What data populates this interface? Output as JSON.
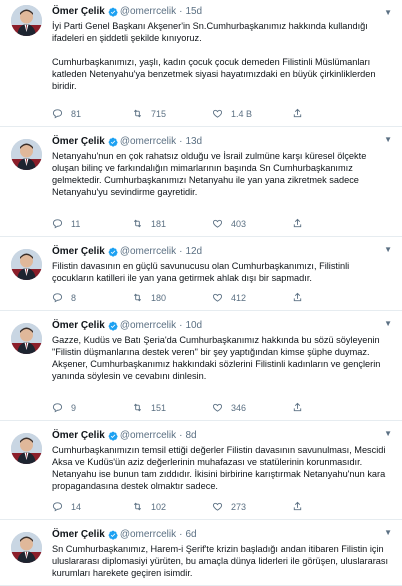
{
  "tweets": [
    {
      "name": "Ömer Çelik",
      "handle": "@omerrcelik",
      "dot": "·",
      "time": "15d",
      "text": "İyi Parti Genel Başkanı Akşener'in Sn.Cumhurbaşkanımız hakkında kullandığı ifadeleri en şiddetli şekilde kınıyoruz.\n\nCumhurbaşkanımızı, yaşlı, kadın çocuk çocuk demeden Filistinli Müslümanları katleden Netenyahu'ya benzetmek siyasi hayatımızdaki en büyük çirkinliklerden biridir.",
      "replies": "81",
      "retweets": "715",
      "likes": "1.4 B"
    },
    {
      "name": "Ömer Çelik",
      "handle": "@omerrcelik",
      "dot": "·",
      "time": "13d",
      "text": "Netanyahu'nun en çok rahatsız olduğu ve İsrail zulmüne karşı küresel ölçekte oluşan bilinç ve farkındalığın mimarlarının başında Sn Cumhurbaşkanımız gelmektedir. Cumhurbaşkanımızı Netanyahu ile yan yana zikretmek sadece Netanyahu'yu sevindirme gayretidir.",
      "replies": "11",
      "retweets": "181",
      "likes": "403"
    },
    {
      "name": "Ömer Çelik",
      "handle": "@omerrcelik",
      "dot": "·",
      "time": "12d",
      "text": "Filistin davasının en güçlü savunucusu olan Cumhurbaşkanımızı, Filistinli çocukların katilleri ile yan yana getirmek ahlak dışı bir sapmadır.",
      "replies": "8",
      "retweets": "180",
      "likes": "412"
    },
    {
      "name": "Ömer Çelik",
      "handle": "@omerrcelik",
      "dot": "·",
      "time": "10d",
      "text": "Gazze, Kudüs ve Batı Şeria'da Cumhurbaşkanımız hakkında bu sözü söyleyenin \"Filistin düşmanlarına destek veren\" bir şey yaptığından kimse şüphe duymaz. Akşener, Cumhurbaşkanımız hakkındaki sözlerini Filistinli kadınların ve gençlerin yanında söylesin ve cevabını dinlesin.",
      "replies": "9",
      "retweets": "151",
      "likes": "346"
    },
    {
      "name": "Ömer Çelik",
      "handle": "@omerrcelik",
      "dot": "·",
      "time": "8d",
      "text": "Cumhurbaşkanımızın temsil ettiği değerler Filistin davasının savunulması, Mescidi Aksa ve Kudüs'ün aziz değerlerinin muhafazası ve statülerinin korunmasıdır. Netanyahu ise bunun tam zıddıdır. İkisini birbirine karıştırmak Netanyahu'nun kara propagandasına destek olmaktır sadece.",
      "replies": "14",
      "retweets": "102",
      "likes": "273"
    },
    {
      "name": "Ömer Çelik",
      "handle": "@omerrcelik",
      "dot": "·",
      "time": "6d",
      "text": "Sn Cumhurbaşkanımız, Harem-i Şerif'te krizin başladığı andan itibaren Filistin için uluslararası diplomasiyi yürüten, bu amaçla dünya liderleri ile görüşen, uluslararası kurumları harekete geçiren isimdir.",
      "replies": "",
      "retweets": "",
      "likes": ""
    }
  ],
  "icons": {
    "reply": "reply-icon",
    "retweet": "retweet-icon",
    "like": "heart-icon",
    "share": "share-icon",
    "verified": "verified-badge-icon",
    "caret": "chevron-down-icon"
  },
  "colors": {
    "verified": "#1da1f2",
    "muted": "#5b7083",
    "divider": "#e6ecf0"
  }
}
